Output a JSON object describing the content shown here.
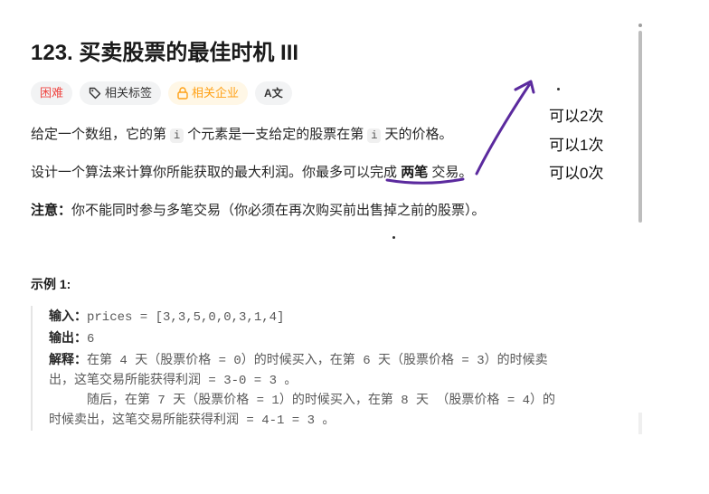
{
  "problem": {
    "title": "123. 买卖股票的最佳时机 III",
    "tags": {
      "difficulty": "困难",
      "related_tags": "相关标签",
      "related_companies": "相关企业",
      "translate": "A文"
    },
    "desc1": {
      "a": "给定一个数组，它的第",
      "code1": "i",
      "b": "个元素是一支给定的股票在第",
      "code2": "i",
      "c": "天的价格。"
    },
    "desc2": {
      "a": "设计一个算法来计算你所能获取的最大利润。你最多可以完成",
      "bold": "两笔",
      "c": "交易。"
    },
    "note": {
      "label": "注意：",
      "text": "你不能同时参与多笔交易（你必须在再次购买前出售掉之前的股票）。"
    },
    "example": {
      "title": "示例 1:",
      "input_label": "输入：",
      "input": "prices = [3,3,5,0,0,3,1,4]",
      "output_label": "输出：",
      "output": "6",
      "explain_label": "解释：",
      "explain1": "在第 4 天（股票价格 = 0）的时候买入，在第 6 天（股票价格 = 3）的时候卖",
      "explain2": "出，这笔交易所能获得利润 = 3-0 = 3 。",
      "explain3": "     随后，在第 7 天（股票价格 = 1）的时候买入，在第 8 天 （股票价格 = 4）的",
      "explain4": "时候卖出，这笔交易所能获得利润 = 4-1 = 3 。"
    }
  },
  "annotations": [
    "可以2次",
    "可以1次",
    "可以0次"
  ],
  "colors": {
    "ink": "#5b2a9e",
    "hard": "#ef4743",
    "company": "#ffa116"
  }
}
